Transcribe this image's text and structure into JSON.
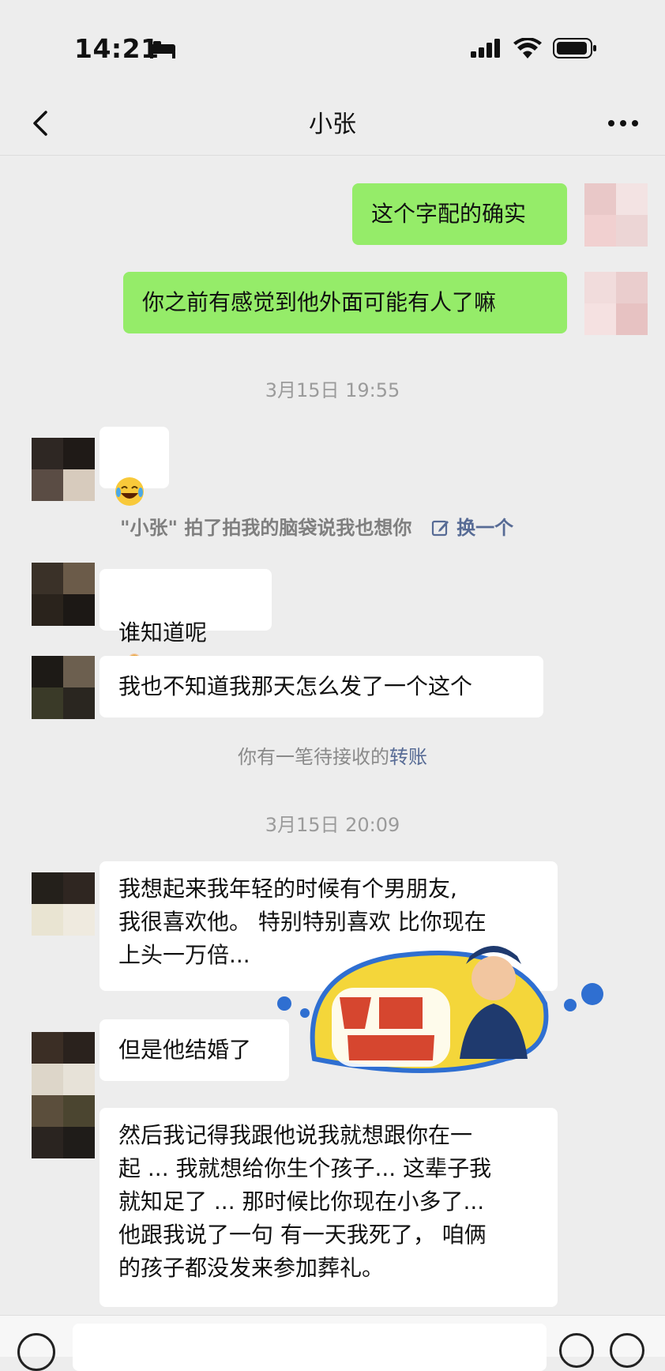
{
  "status_bar": {
    "time": "14:21"
  },
  "nav": {
    "title": "小张",
    "back_icon": "chevron-left-icon",
    "more_icon": "more-dots-icon"
  },
  "messages": [
    {
      "side": "right",
      "text": "这个字配的确实"
    },
    {
      "side": "right",
      "text": "你之前有感觉到他外面可能有人了嘛"
    }
  ],
  "timestamps": [
    "3月15日 19:55",
    "3月15日 20:09"
  ],
  "incoming": [
    {
      "emoji": "laughing-crying-emoji"
    },
    {
      "text": "谁知道呢",
      "emoji": "person-shrugging-emoji"
    },
    {
      "text": "我也不知道我那天怎么发了一个这个"
    },
    {
      "text": "我想起来我年轻的时候有个男朋友,\n我很喜欢他。 特别特别喜欢 比你现在\n上头一万倍..."
    },
    {
      "text": "但是他结婚了"
    },
    {
      "text": "然后我记得我跟他说我就想跟你在一\n起 ... 我就想给你生个孩子... 这辈子我\n就知足了 ... 那时候比你现在小多了...\n他跟我说了一句 有一天我死了， 咱俩\n的孩子都没发来参加葬礼。"
    }
  ],
  "pat": {
    "text": "\"小张\" 拍了拍我的脑袋说我也想你",
    "action": "换一个"
  },
  "transfer_notice": {
    "prefix": "你有一笔待接收的",
    "link": "转账"
  },
  "colors": {
    "green_bubble": "#95ec69",
    "background": "#ededed",
    "link": "#576b95"
  }
}
